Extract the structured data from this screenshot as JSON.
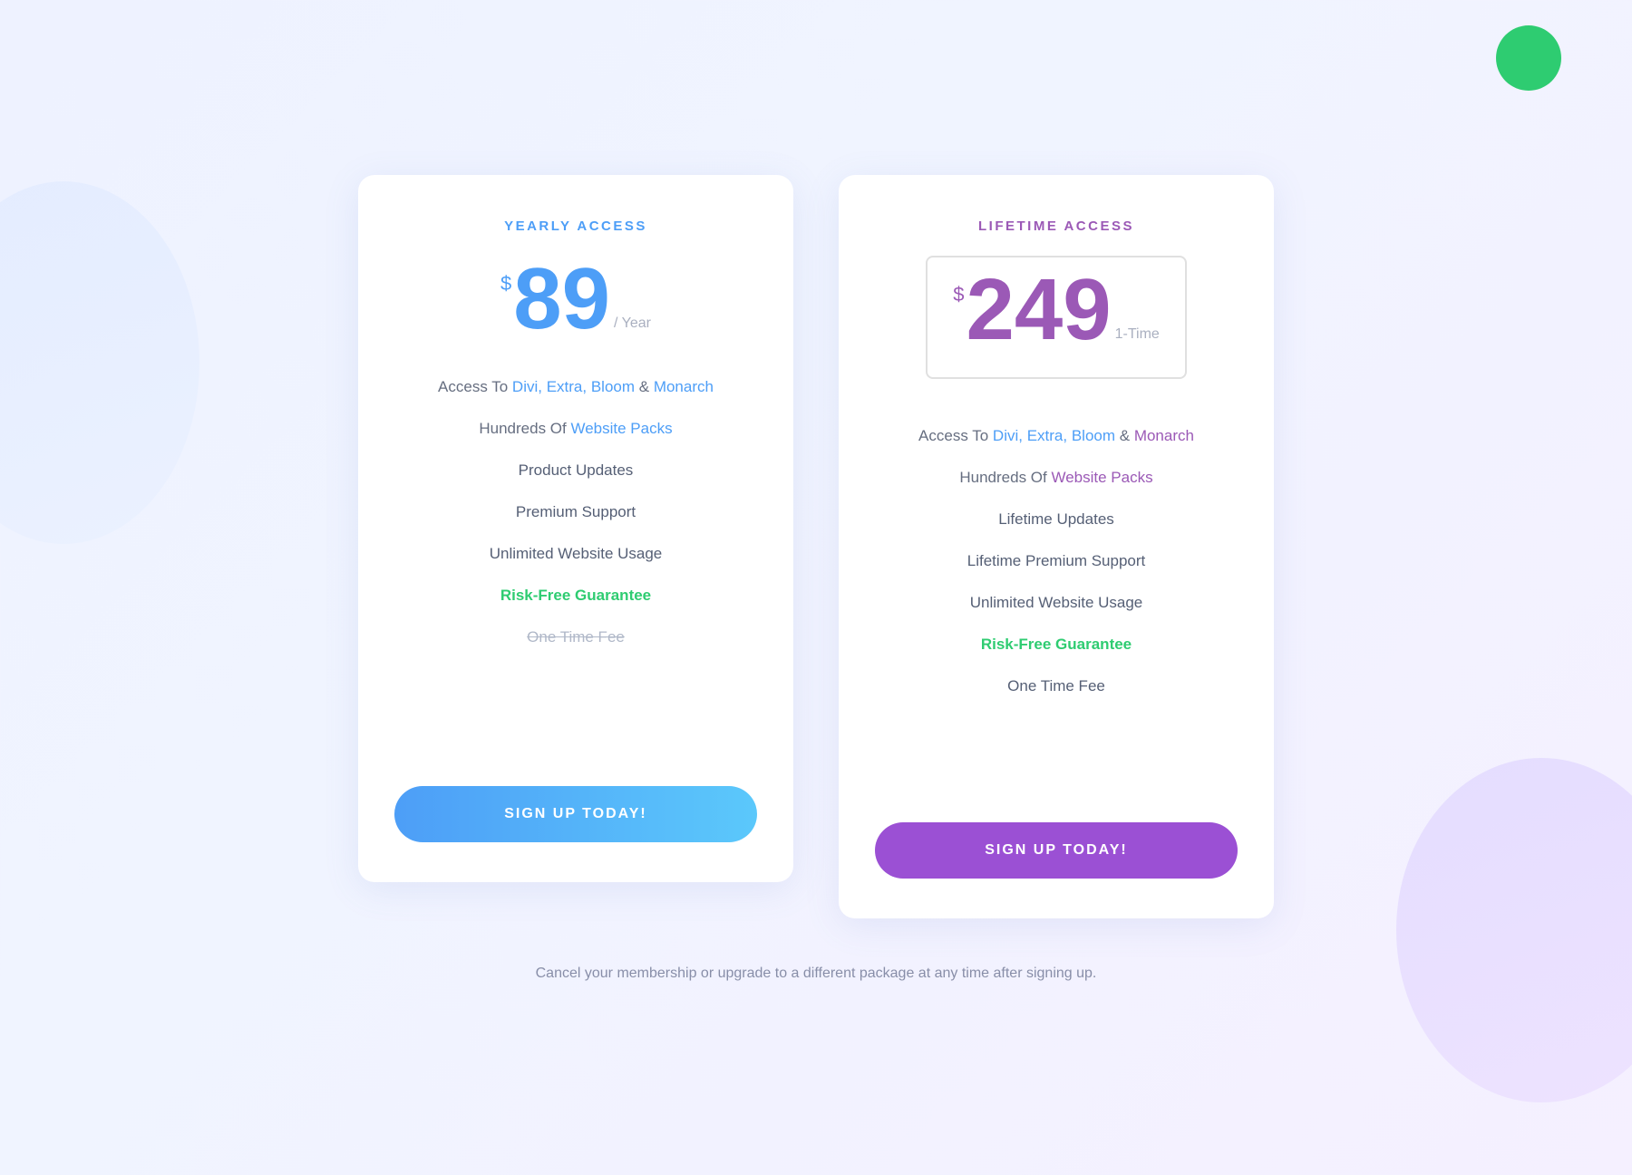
{
  "background_dot": {
    "color": "#2ecc71"
  },
  "yearly_card": {
    "plan_title": "YEARLY ACCESS",
    "price_dollar": "$",
    "price_amount": "89",
    "price_suffix": "/ Year",
    "features": [
      {
        "id": "access",
        "prefix": "Access To ",
        "highlighted": "Divi, Extra, Bloom",
        "connector": " & ",
        "highlighted2": "Monarch",
        "plain": ""
      },
      {
        "id": "website_packs",
        "prefix": "Hundreds Of ",
        "highlighted": "Website Packs",
        "plain": ""
      },
      {
        "id": "updates",
        "text": "Product Updates",
        "type": "normal"
      },
      {
        "id": "support",
        "text": "Premium Support",
        "type": "normal"
      },
      {
        "id": "usage",
        "text": "Unlimited Website Usage",
        "type": "normal"
      },
      {
        "id": "guarantee",
        "text": "Risk-Free Guarantee",
        "type": "green"
      },
      {
        "id": "one_time",
        "text": "One Time Fee",
        "type": "strikethrough"
      }
    ],
    "cta_label": "SIGN UP TODAY!"
  },
  "lifetime_card": {
    "plan_title": "LIFETIME ACCESS",
    "price_dollar": "$",
    "price_amount": "249",
    "price_suffix": "1-Time",
    "features": [
      {
        "id": "access",
        "prefix": "Access To ",
        "highlighted": "Divi, Extra, Bloom",
        "connector": " & ",
        "highlighted2": "Monarch",
        "plain": ""
      },
      {
        "id": "website_packs",
        "prefix": "Hundreds Of ",
        "highlighted": "Website Packs",
        "plain": ""
      },
      {
        "id": "updates",
        "text": "Lifetime Updates",
        "type": "normal"
      },
      {
        "id": "support",
        "text": "Lifetime Premium Support",
        "type": "normal"
      },
      {
        "id": "usage",
        "text": "Unlimited Website Usage",
        "type": "normal"
      },
      {
        "id": "guarantee",
        "text": "Risk-Free Guarantee",
        "type": "green"
      },
      {
        "id": "one_time",
        "text": "One Time Fee",
        "type": "normal"
      }
    ],
    "cta_label": "SIGN UP TODAY!"
  },
  "footer": {
    "note": "Cancel your membership or upgrade to a different package at any time after signing up."
  }
}
